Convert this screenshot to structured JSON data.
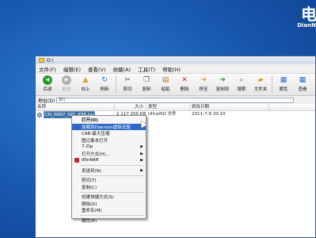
{
  "brand": {
    "logo_main": "电",
    "logo_sub": "DianN"
  },
  "window": {
    "title": "D:\\"
  },
  "menubar": [
    "文件(F)",
    "编辑(E)",
    "查看(V)",
    "收藏(A)",
    "工具(T)",
    "帮助(H)"
  ],
  "toolbar": [
    {
      "label": "后退",
      "icon": "back-arrow-icon",
      "glyph": "◀",
      "color": "#2a9a2a",
      "disabled": false
    },
    {
      "label": "前进",
      "icon": "forward-arrow-icon",
      "glyph": "▶",
      "color": "#b0b0b0",
      "disabled": true
    },
    {
      "label": "向上",
      "icon": "folder-up-icon",
      "glyph": "▲",
      "color": "#d9a528",
      "disabled": false
    },
    {
      "label": "刷新",
      "icon": "refresh-icon",
      "glyph": "↻",
      "color": "#2a6fcf",
      "disabled": false
    },
    {
      "label": "剪切",
      "icon": "scissors-icon",
      "glyph": "✂",
      "color": "#2a5fb0",
      "disabled": false
    },
    {
      "label": "复制",
      "icon": "copy-icon",
      "glyph": "❐",
      "color": "#5a5a5a",
      "disabled": false
    },
    {
      "label": "粘贴",
      "icon": "paste-icon",
      "glyph": "▤",
      "color": "#b07a28",
      "disabled": false
    },
    {
      "label": "删除",
      "icon": "delete-icon",
      "glyph": "✕",
      "color": "#d22",
      "disabled": false
    },
    {
      "label": "移至",
      "icon": "move-to-icon",
      "glyph": "➜",
      "color": "#d9a528",
      "disabled": false
    },
    {
      "label": "复制到",
      "icon": "copy-to-icon",
      "glyph": "➜",
      "color": "#2a9a2a",
      "disabled": false
    },
    {
      "label": "搜索",
      "icon": "search-icon",
      "glyph": "⌕",
      "color": "#2a6fcf",
      "disabled": false
    },
    {
      "label": "文件夹",
      "icon": "folder-icon",
      "glyph": "▰",
      "color": "#d9a528",
      "disabled": false
    },
    {
      "label": "属性",
      "icon": "properties-icon",
      "glyph": "▦",
      "color": "#2a6fcf",
      "disabled": false
    },
    {
      "label": "查看",
      "icon": "view-icon",
      "glyph": "▦",
      "color": "#2a6fcf",
      "disabled": false
    }
  ],
  "address": {
    "label": "地址(D)",
    "value": "D:\\"
  },
  "columns": [
    "名称",
    "大小",
    "类型",
    "修改日期"
  ],
  "files": [
    {
      "name": "CN_WIN7_SP1_X86.iso",
      "size": "2 117 200 KB",
      "type": "UltraISO 文件",
      "date": "2011-7-9 20:10"
    }
  ],
  "context_menu": [
    {
      "type": "item",
      "label": "打开(O)",
      "bold": true
    },
    {
      "type": "item",
      "label": "加载到Daemon虚拟光驱",
      "highlighted": true
    },
    {
      "type": "item",
      "label": "CAB-最大压缩"
    },
    {
      "type": "item",
      "label": "图记事本打开"
    },
    {
      "type": "item",
      "label": "7-Zip",
      "submenu": true
    },
    {
      "type": "item",
      "label": "打开方式(H)...",
      "submenu": true
    },
    {
      "type": "item",
      "label": "WinRAR",
      "submenu": true,
      "icon": true
    },
    {
      "type": "sep"
    },
    {
      "type": "item",
      "label": "发送到(N)",
      "submenu": true
    },
    {
      "type": "sep"
    },
    {
      "type": "item",
      "label": "剪切(T)"
    },
    {
      "type": "item",
      "label": "复制(C)"
    },
    {
      "type": "sep"
    },
    {
      "type": "item",
      "label": "创建快捷方式(S)"
    },
    {
      "type": "item",
      "label": "删除(D)"
    },
    {
      "type": "item",
      "label": "重命名(M)"
    },
    {
      "type": "sep"
    },
    {
      "type": "item",
      "label": "属性(R)"
    }
  ]
}
